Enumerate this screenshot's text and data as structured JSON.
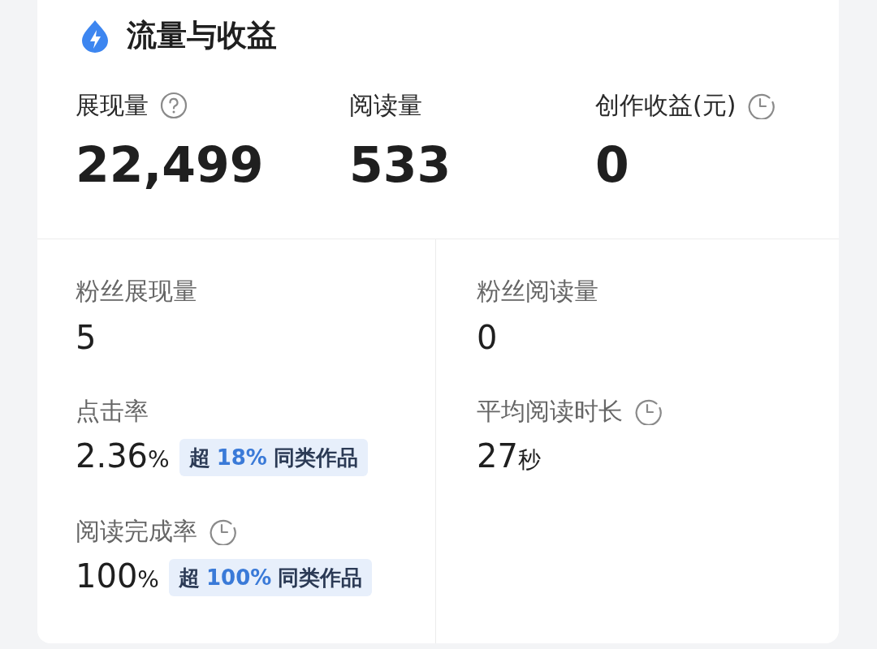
{
  "title": "流量与收益",
  "top_stats": [
    {
      "kind": "help",
      "label": "展现量",
      "value": "22,499"
    },
    {
      "kind": "plain",
      "label": "阅读量",
      "value": "533"
    },
    {
      "kind": "timed",
      "label": "创作收益(元)",
      "value": "0"
    }
  ],
  "left_metrics": [
    {
      "kind": "plain",
      "label": "粉丝展现量",
      "value": "5"
    },
    {
      "kind": "plain",
      "label": "点击率",
      "value": "2.36",
      "unit": "%",
      "badge": {
        "prefix": "超",
        "percent": "18%",
        "suffix": "同类作品"
      }
    },
    {
      "kind": "timed",
      "label": "阅读完成率",
      "value": "100",
      "unit": "%",
      "badge": {
        "prefix": "超",
        "percent": "100%",
        "suffix": "同类作品"
      }
    }
  ],
  "right_metrics": [
    {
      "kind": "plain",
      "label": "粉丝阅读量",
      "value": "0"
    },
    {
      "kind": "timed",
      "label": "平均阅读时长",
      "value": "27",
      "unit": "秒"
    }
  ]
}
